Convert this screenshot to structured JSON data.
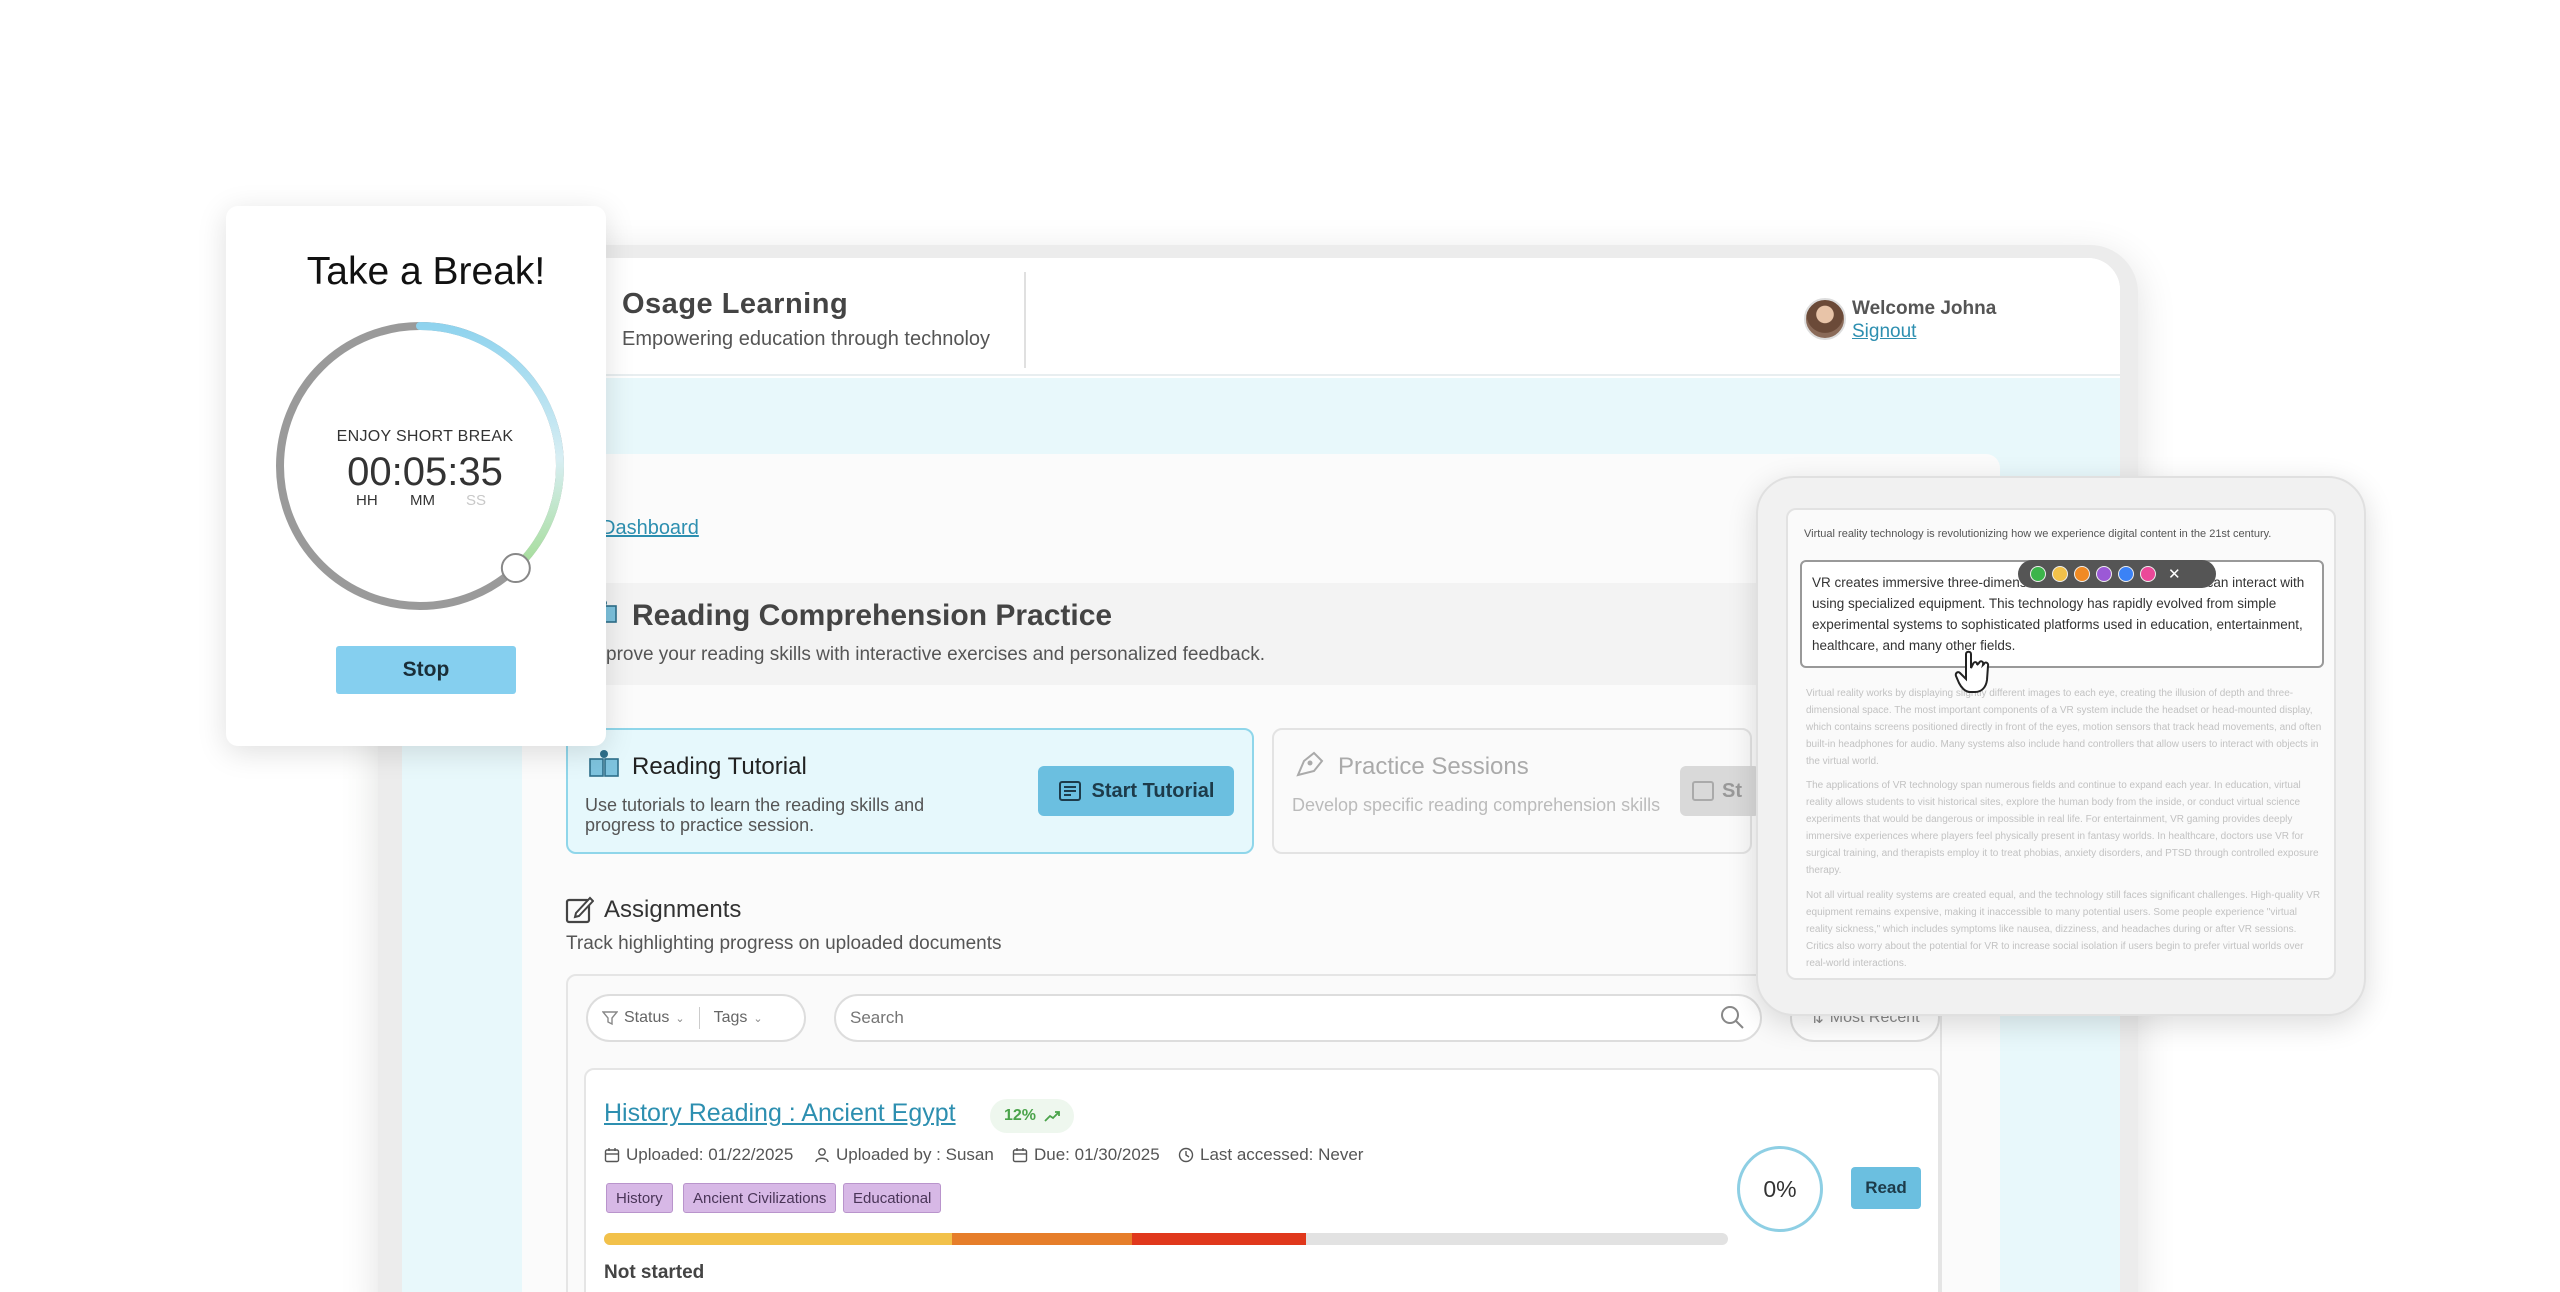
{
  "header": {
    "app_name": "Osage Learning",
    "tagline": "Empowering education through technoloy",
    "welcome": "Welcome Johna",
    "signout": "Signout"
  },
  "breadcrumb": "Dashboard",
  "section": {
    "title": "Reading Comprehension Practice",
    "subtitle": "prove your reading skills with interactive exercises and personalized feedback."
  },
  "cards": {
    "tutorial": {
      "title": "Reading Tutorial",
      "description": "Use tutorials to learn the reading skills and progress to practice session.",
      "button": "Start Tutorial"
    },
    "practice": {
      "title": "Practice Sessions",
      "description": "Develop specific reading comprehension skills",
      "button": "St"
    }
  },
  "assignments": {
    "title": "Assignments",
    "subtitle": "Track highlighting progress on uploaded documents",
    "filters": {
      "status": "Status",
      "tags": "Tags"
    },
    "search_placeholder": "Search",
    "sort": "Most Recent",
    "items": [
      {
        "title": "History Reading : Ancient Egypt",
        "trend_badge": "12%",
        "uploaded": "Uploaded: 01/22/2025",
        "uploaded_by": "Uploaded by : Susan",
        "due": "Due: 01/30/2025",
        "last_accessed": "Last accessed: Never",
        "tags": [
          "History",
          "Ancient Civilizations",
          "Educational"
        ],
        "status": "Not started",
        "completion": "0%",
        "read_button": "Read",
        "progress_segments": [
          {
            "fraction": 0.31,
            "color": "#f2c14a"
          },
          {
            "fraction": 0.16,
            "color": "#e67e2a"
          },
          {
            "fraction": 0.155,
            "color": "#e0381c"
          }
        ]
      }
    ]
  },
  "break_timer": {
    "title": "Take a Break!",
    "caption": "ENJOY SHORT BREAK",
    "time": "00:05:35",
    "units": {
      "hh": "HH",
      "mm": "MM",
      "ss": "SS"
    },
    "elapsed_fraction": 0.38,
    "stop_label": "Stop"
  },
  "reader": {
    "first_line": "Virtual reality technology is revolutionizing how we experience digital content in the 21st century.",
    "highlighted": "VR creates immersive three-dimensional environments that users can interact with using specialized equipment. This technology has rapidly evolved from simple experimental systems to sophisticated platforms used in education, entertainment, healthcare, and many other fields.",
    "paragraphs": [
      "Virtual reality works by displaying slightly different images to each eye, creating the illusion of depth and three-dimensional space. The most important components of a VR system include the headset or head-mounted display, which contains screens positioned directly in front of the eyes, motion sensors that track head movements, and often built-in headphones for audio. Many systems also include hand controllers that allow users to interact with objects in the virtual world.",
      "The applications of VR technology span numerous fields and continue to expand each year. In education, virtual reality allows students to visit historical sites, explore the human body from the inside, or conduct virtual science experiments that would be dangerous or impossible in real life. For entertainment, VR gaming provides deeply immersive experiences where players feel physically present in fantasy worlds. In healthcare, doctors use VR for surgical training, and therapists employ it to treat phobias, anxiety disorders, and PTSD through controlled exposure therapy.",
      "Not all virtual reality systems are created equal, and the technology still faces significant challenges. High-quality VR equipment remains expensive, making it inaccessible to many potential users. Some people experience \"virtual reality sickness,\" which includes symptoms like nausea, dizziness, and headaches during or after VR sessions. Critics also worry about the potential for VR to increase social isolation if users begin to prefer virtual worlds over real-world interactions."
    ],
    "highlight_colors": [
      "#3cb44b",
      "#f2c14a",
      "#f08a24",
      "#9b59d6",
      "#3b82f6",
      "#ec4899"
    ]
  }
}
